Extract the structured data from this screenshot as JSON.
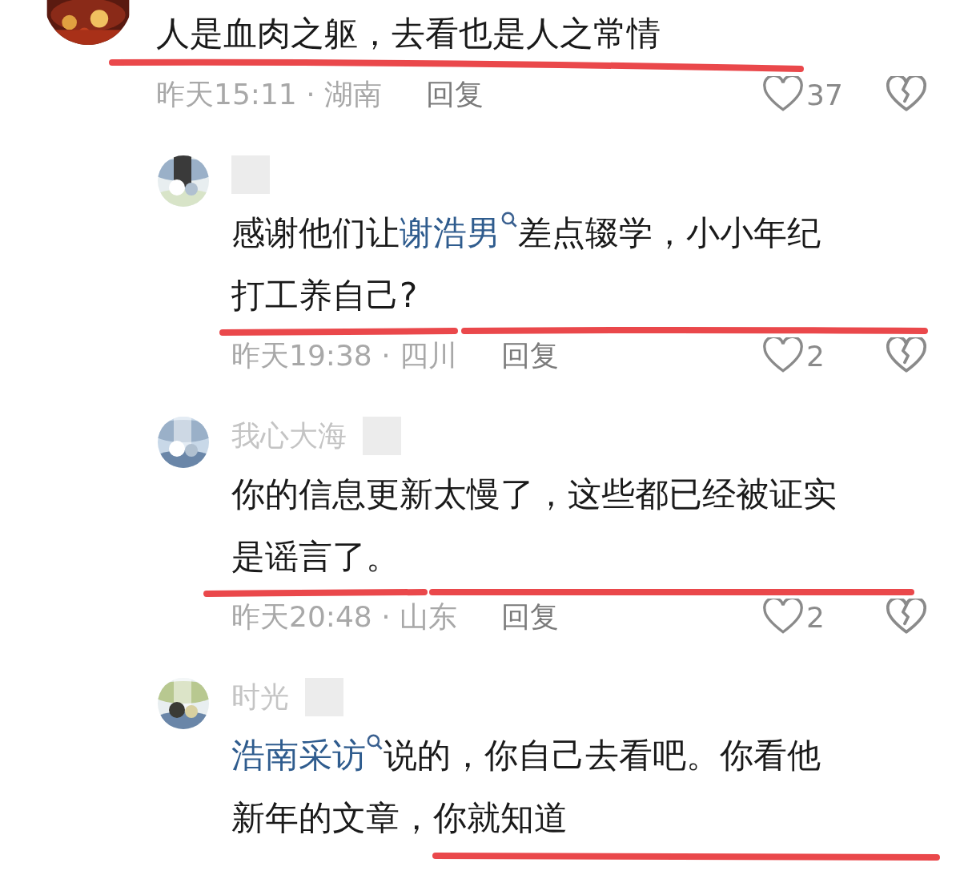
{
  "comment": {
    "avatar": {
      "kind": "picture"
    },
    "lines": [
      [
        {
          "kind": "plain",
          "text": "人是血肉之躯，去看也是人之常情"
        }
      ]
    ],
    "meta": {
      "info": "昨天15:11 · 湖南",
      "reply": "回复",
      "likes": "37",
      "liked": false
    },
    "replies": [
      {
        "lines": [
          [
            {
              "kind": "plain",
              "text": "感谢他们让"
            },
            {
              "kind": "mention",
              "text": "谢浩男"
            },
            {
              "kind": "plain",
              "text": "差点辍学，小小年纪"
            }
          ],
          [
            {
              "kind": "plain",
              "text": "打工养自己?"
            }
          ]
        ],
        "meta": {
          "info": "昨天19:38 · 四川",
          "reply": "回复",
          "likes": "2",
          "liked": false
        }
      },
      {
        "username": "我心大海",
        "lines": [
          [
            {
              "kind": "plain",
              "text": "你的信息更新太慢了，这些都已经被证实"
            }
          ],
          [
            {
              "kind": "plain",
              "text": "是谣言了。"
            }
          ]
        ],
        "meta": {
          "info": "昨天20:48 · 山东",
          "reply": "回复",
          "likes": "2",
          "liked": false
        }
      },
      {
        "username": "时光",
        "lines": [
          [
            {
              "kind": "mention",
              "text": "浩南采访"
            },
            {
              "kind": "plain",
              "text": "说的，你自己去看吧。你看他"
            }
          ],
          [
            {
              "kind": "plain",
              "text": "新年的文章，你就知道"
            }
          ]
        ]
      }
    ]
  }
}
